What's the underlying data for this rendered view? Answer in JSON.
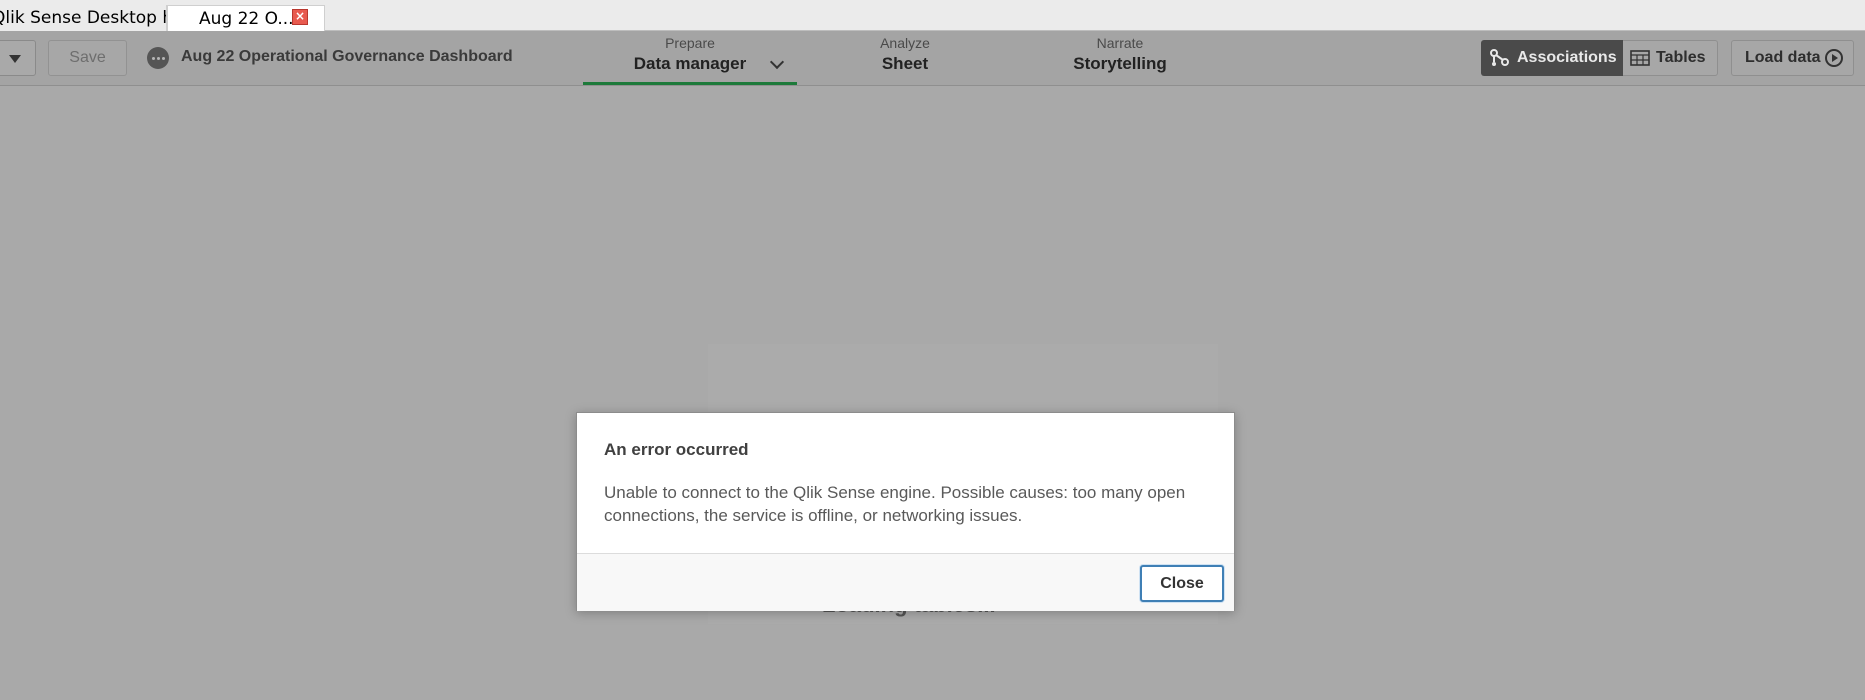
{
  "tabs": {
    "hub_label": "Qlik Sense Desktop hub",
    "active_label": "Aug 22 O...",
    "close_glyph": "×"
  },
  "toolbar": {
    "save_label": "Save",
    "app_title": "Aug 22 Operational Governance Dashboard",
    "nav": {
      "prepare": {
        "sub": "Prepare",
        "main": "Data manager"
      },
      "analyze": {
        "sub": "Analyze",
        "main": "Sheet"
      },
      "narrate": {
        "sub": "Narrate",
        "main": "Storytelling"
      }
    },
    "associations_label": "Associations",
    "tables_label": "Tables",
    "load_data_label": "Load data"
  },
  "content": {
    "loading_text": "Loading tables..."
  },
  "dialog": {
    "title": "An error occurred",
    "message": "Unable to connect to the Qlik Sense engine. Possible causes: too many open connections, the service is offline, or networking issues.",
    "close_label": "Close"
  },
  "colors": {
    "active_nav_underline": "#1d7a3a",
    "associations_bg": "#4a4a4a",
    "close_button_border": "#3f7fb5",
    "tab_close_red": "#e85a4f"
  }
}
